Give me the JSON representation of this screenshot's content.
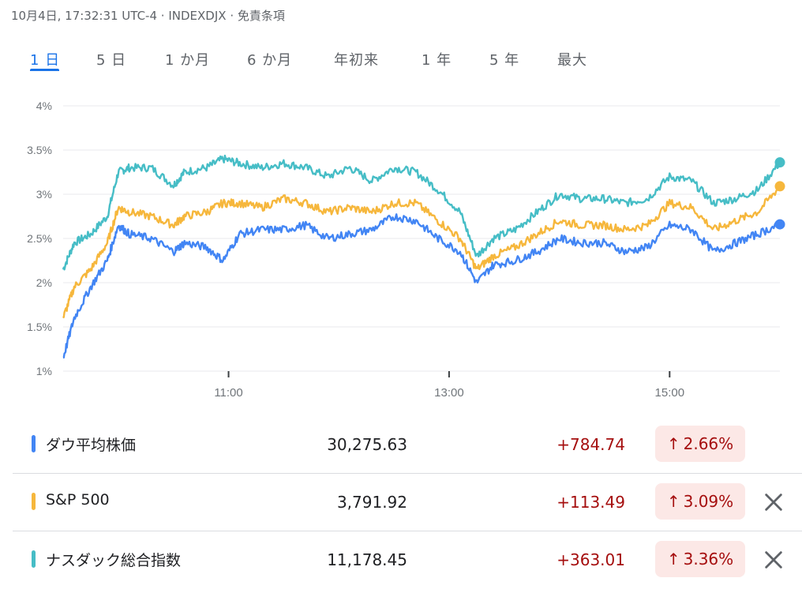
{
  "header": {
    "datetime": "10月4日, 17:32:31 UTC-4",
    "index_code": "INDEXDJX",
    "disclaimer": "免責条項",
    "separator": "·"
  },
  "tabs": [
    {
      "label": "1 日",
      "active": true
    },
    {
      "label": "5 日",
      "active": false
    },
    {
      "label": "1 か月",
      "active": false
    },
    {
      "label": "6 か月",
      "active": false
    },
    {
      "label": "年初来",
      "active": false
    },
    {
      "label": "1 年",
      "active": false
    },
    {
      "label": "5 年",
      "active": false
    },
    {
      "label": "最大",
      "active": false
    }
  ],
  "colors": {
    "accent": "#1a73e8",
    "dow": "#4285f4",
    "sp500": "#f6b73c",
    "nasdaq": "#46bdc6",
    "positive": "#a50e0e",
    "positive_bg": "#fce8e6",
    "grid": "#e8eaed"
  },
  "chart_data": {
    "type": "line",
    "ylim": [
      1,
      4
    ],
    "y_ticks": [
      "1%",
      "1.5%",
      "2%",
      "2.5%",
      "3%",
      "3.5%",
      "4%"
    ],
    "x_ticks": [
      "11:00",
      "13:00",
      "15:00"
    ],
    "x_tick_hours": [
      11,
      13,
      15
    ],
    "x_range_hours": [
      9.5,
      16
    ],
    "grid": true,
    "series": [
      {
        "name": "ナスダック総合指数",
        "color": "#46bdc6",
        "x": [
          9.5,
          9.6,
          9.75,
          9.9,
          10.0,
          10.1,
          10.3,
          10.5,
          10.6,
          10.8,
          10.95,
          11.1,
          11.3,
          11.5,
          11.7,
          11.9,
          12.1,
          12.3,
          12.5,
          12.7,
          12.9,
          13.1,
          13.25,
          13.4,
          13.6,
          13.8,
          14.0,
          14.2,
          14.4,
          14.6,
          14.8,
          15.0,
          15.2,
          15.4,
          15.6,
          15.8,
          16.0
        ],
        "values": [
          2.15,
          2.45,
          2.55,
          2.75,
          3.25,
          3.3,
          3.3,
          3.1,
          3.25,
          3.3,
          3.4,
          3.35,
          3.3,
          3.35,
          3.3,
          3.2,
          3.3,
          3.15,
          3.3,
          3.25,
          3.05,
          2.8,
          2.3,
          2.5,
          2.6,
          2.8,
          3.0,
          2.95,
          2.95,
          2.9,
          2.95,
          3.2,
          3.15,
          2.9,
          2.95,
          3.05,
          3.36
        ]
      },
      {
        "name": "S&P 500",
        "color": "#f6b73c",
        "x": [
          9.5,
          9.6,
          9.75,
          9.9,
          10.0,
          10.1,
          10.3,
          10.5,
          10.6,
          10.8,
          10.95,
          11.1,
          11.3,
          11.5,
          11.7,
          11.9,
          12.1,
          12.3,
          12.5,
          12.7,
          12.9,
          13.1,
          13.25,
          13.4,
          13.6,
          13.8,
          14.0,
          14.2,
          14.4,
          14.6,
          14.8,
          15.0,
          15.2,
          15.4,
          15.6,
          15.8,
          16.0
        ],
        "values": [
          1.6,
          1.95,
          2.15,
          2.45,
          2.85,
          2.8,
          2.75,
          2.65,
          2.75,
          2.8,
          2.9,
          2.9,
          2.85,
          2.95,
          2.9,
          2.8,
          2.85,
          2.8,
          2.9,
          2.9,
          2.7,
          2.5,
          2.15,
          2.3,
          2.4,
          2.55,
          2.7,
          2.65,
          2.65,
          2.6,
          2.65,
          2.9,
          2.85,
          2.6,
          2.7,
          2.8,
          3.09
        ]
      },
      {
        "name": "ダウ平均株価",
        "color": "#4285f4",
        "x": [
          9.5,
          9.6,
          9.75,
          9.9,
          10.0,
          10.1,
          10.3,
          10.5,
          10.6,
          10.8,
          10.95,
          11.1,
          11.3,
          11.5,
          11.7,
          11.9,
          12.1,
          12.3,
          12.5,
          12.7,
          12.9,
          13.1,
          13.25,
          13.4,
          13.6,
          13.8,
          14.0,
          14.2,
          14.4,
          14.6,
          14.8,
          15.0,
          15.2,
          15.4,
          15.6,
          15.8,
          16.0
        ],
        "values": [
          1.15,
          1.6,
          1.95,
          2.25,
          2.65,
          2.55,
          2.5,
          2.35,
          2.45,
          2.4,
          2.25,
          2.55,
          2.6,
          2.6,
          2.65,
          2.5,
          2.55,
          2.6,
          2.75,
          2.7,
          2.5,
          2.35,
          2.0,
          2.2,
          2.25,
          2.35,
          2.5,
          2.45,
          2.45,
          2.35,
          2.4,
          2.65,
          2.6,
          2.35,
          2.45,
          2.55,
          2.66
        ]
      }
    ]
  },
  "rows": [
    {
      "name": "ダウ平均株価",
      "value": "30,275.63",
      "change": "+784.74",
      "pct": "2.66%",
      "color": "#4285f4",
      "removable": false
    },
    {
      "name": "S&P 500",
      "value": "3,791.92",
      "change": "+113.49",
      "pct": "3.09%",
      "color": "#f6b73c",
      "removable": true
    },
    {
      "name": "ナスダック総合指数",
      "value": "11,178.45",
      "change": "+363.01",
      "pct": "3.36%",
      "color": "#46bdc6",
      "removable": true
    }
  ],
  "icons": {
    "up_arrow": "↑",
    "close": "close-icon"
  }
}
